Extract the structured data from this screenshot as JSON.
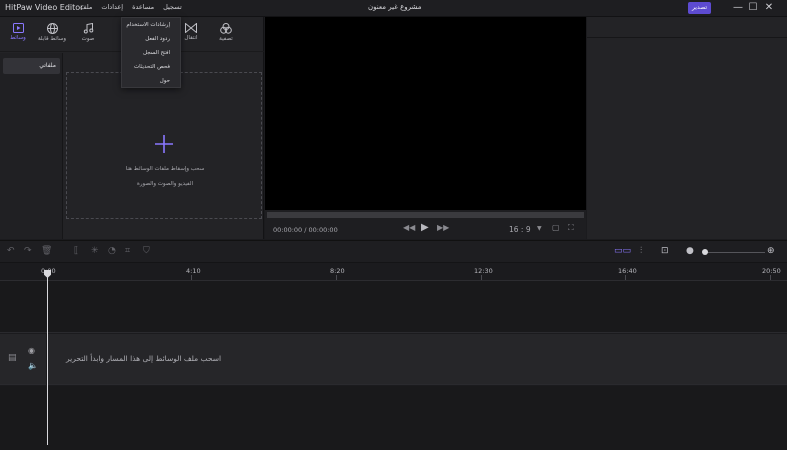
{
  "titlebar": {
    "app_title": "HitPaw Video Editor",
    "menu": [
      "تسجيل",
      "مساعدة",
      "إعدادات",
      "ملف"
    ],
    "project_title": "مشروع غير معنون",
    "export_label": "تصدير",
    "minimize": "—",
    "maximize": "☐",
    "close": "✕"
  },
  "toolbar": {
    "tools": [
      {
        "label": "وسائط",
        "icon": "media-icon"
      },
      {
        "label": "وسائط قابلة",
        "icon": "globe-icon"
      },
      {
        "label": "صوت",
        "icon": "music-icon"
      },
      {
        "label": "انتقال",
        "icon": "transition-icon"
      },
      {
        "label": "تصفية",
        "icon": "filter-icon"
      }
    ]
  },
  "dropdown": {
    "items": [
      "إرشادات الاستخدام",
      "ردود الفعل",
      "افتح السجل",
      "فحص التحديثات",
      "حول"
    ]
  },
  "sidebar": {
    "item": "ملفاتي"
  },
  "dropzone": {
    "line1": "سحب وإسقاط ملفات الوسائط هنا",
    "line2": "الفيديو والصوت والصورة"
  },
  "preview": {
    "time": "00:00:00 / 00:00:00",
    "ratio": "16 : 9"
  },
  "timeline": {
    "ticks": [
      "0:00",
      "4:10",
      "8:20",
      "12:30",
      "16:40",
      "20:50"
    ],
    "track_hint": "اسحب ملف الوسائط إلى هذا المسار وابدأ التحرير"
  }
}
